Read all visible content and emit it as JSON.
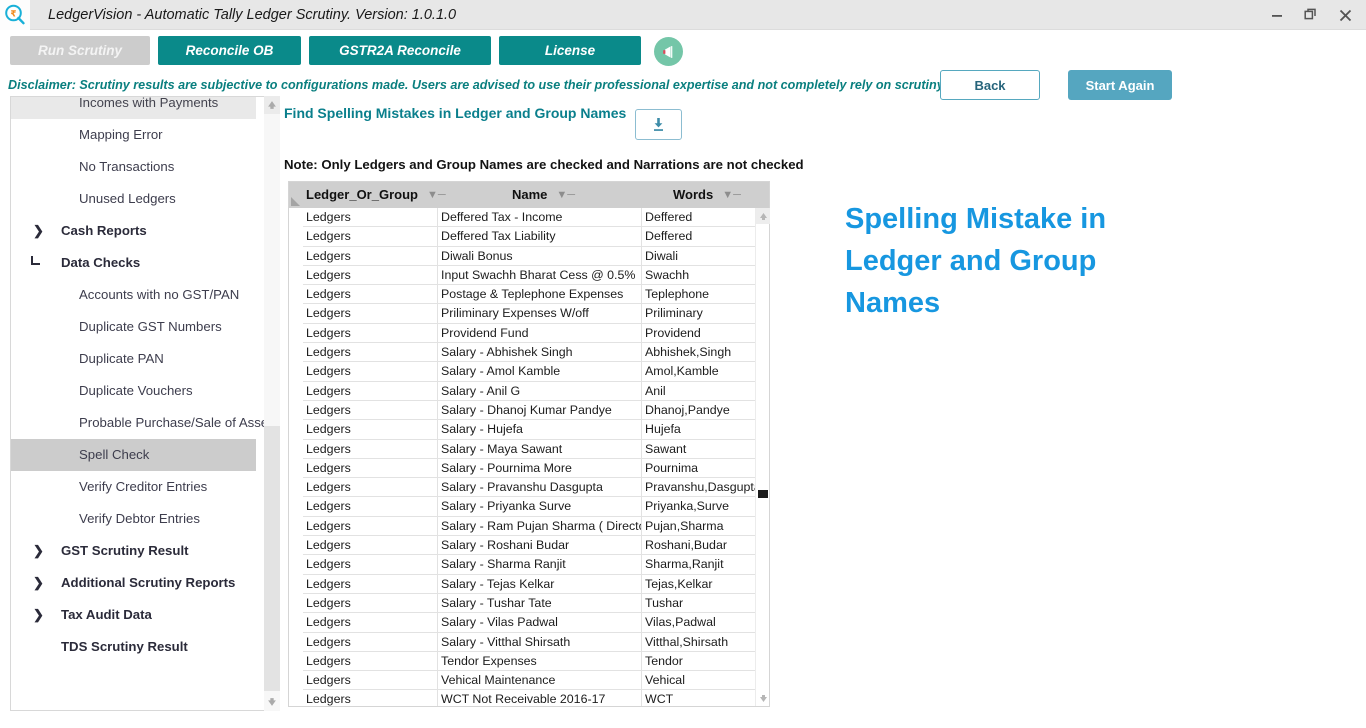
{
  "window": {
    "title": "LedgerVision - Automatic Tally Ledger Scrutiny.  Version: 1.0.1.0",
    "app_icon": "rupee-magnifier-icon",
    "minimize": "–",
    "maximize": "❐",
    "close": "✕"
  },
  "toolbar": {
    "run_scrutiny": "Run Scrutiny",
    "reconcile_ob": "Reconcile OB",
    "gstr2a_reconcile": "GSTR2A Reconcile",
    "license": "License",
    "announce_icon": "megaphone-icon",
    "colors": {
      "teal": "#0a8a8a",
      "disabled": "#cccccc",
      "accent_blue": "#55a6c0",
      "headline_blue": "#1797e0"
    }
  },
  "disclaimer": {
    "text": "Disclaimer: Scrutiny results are subjective to configurations made. Users are advised to use their professional expertise and not completely rely on scrutiny results.",
    "back": "Back",
    "start_again": "Start Again"
  },
  "sidebar": {
    "items": [
      {
        "label": "Incomes with Payments",
        "level": "child",
        "state": "partial"
      },
      {
        "label": "Mapping Error",
        "level": "child",
        "state": "normal"
      },
      {
        "label": "No Transactions",
        "level": "child",
        "state": "normal"
      },
      {
        "label": "Unused Ledgers",
        "level": "child",
        "state": "normal"
      },
      {
        "label": "Cash Reports",
        "level": "group",
        "state": "collapsed"
      },
      {
        "label": "Data Checks",
        "level": "group",
        "state": "expanded"
      },
      {
        "label": "Accounts with no GST/PAN",
        "level": "child",
        "state": "normal"
      },
      {
        "label": "Duplicate GST Numbers",
        "level": "child",
        "state": "normal"
      },
      {
        "label": "Duplicate PAN",
        "level": "child",
        "state": "normal"
      },
      {
        "label": "Duplicate Vouchers",
        "level": "child",
        "state": "normal"
      },
      {
        "label": "Probable Purchase/Sale of Assets",
        "level": "child",
        "state": "normal"
      },
      {
        "label": "Spell Check",
        "level": "child",
        "state": "selected"
      },
      {
        "label": "Verify Creditor Entries",
        "level": "child",
        "state": "normal"
      },
      {
        "label": "Verify Debtor Entries",
        "level": "child",
        "state": "normal"
      },
      {
        "label": "GST Scrutiny Result",
        "level": "group",
        "state": "collapsed"
      },
      {
        "label": "Additional Scrutiny Reports",
        "level": "group",
        "state": "collapsed"
      },
      {
        "label": "Tax Audit Data",
        "level": "group",
        "state": "collapsed"
      },
      {
        "label": "TDS Scrutiny Result",
        "level": "group",
        "state": "leaf"
      }
    ],
    "chevron_collapsed": "❯",
    "scroll_up_icon": "↑",
    "scroll_down_icon": "↓"
  },
  "content": {
    "title": "Find Spelling Mistakes in Ledger and Group Names",
    "download_icon": "download-icon",
    "note": "Note: Only Ledgers and Group Names are checked and Narrations are not checked",
    "right_headline": "Spelling Mistake in Ledger and Group Names"
  },
  "grid": {
    "columns": [
      "Ledger_Or_Group",
      "Name",
      "Words"
    ],
    "filter_icon": "᎒",
    "rows": [
      [
        "Ledgers",
        "Deffered Tax - Income",
        "Deffered"
      ],
      [
        "Ledgers",
        "Deffered Tax Liability",
        "Deffered"
      ],
      [
        "Ledgers",
        "Diwali Bonus",
        "Diwali"
      ],
      [
        "Ledgers",
        "Input Swachh Bharat Cess @ 0.5%",
        "Swachh"
      ],
      [
        "Ledgers",
        "Postage & Teplephone Expenses",
        "Teplephone"
      ],
      [
        "Ledgers",
        "Priliminary Expenses W/off",
        "Priliminary"
      ],
      [
        "Ledgers",
        "Providend Fund",
        "Providend"
      ],
      [
        "Ledgers",
        "Salary - Abhishek Singh",
        "Abhishek,Singh"
      ],
      [
        "Ledgers",
        "Salary - Amol Kamble",
        "Amol,Kamble"
      ],
      [
        "Ledgers",
        "Salary - Anil G",
        "Anil"
      ],
      [
        "Ledgers",
        "Salary - Dhanoj Kumar Pandye",
        "Dhanoj,Pandye"
      ],
      [
        "Ledgers",
        "Salary - Hujefa",
        "Hujefa"
      ],
      [
        "Ledgers",
        "Salary - Maya Sawant",
        "Sawant"
      ],
      [
        "Ledgers",
        "Salary - Pournima More",
        "Pournima"
      ],
      [
        "Ledgers",
        "Salary - Pravanshu Dasgupta",
        "Pravanshu,Dasgupta"
      ],
      [
        "Ledgers",
        "Salary - Priyanka Surve",
        "Priyanka,Surve"
      ],
      [
        "Ledgers",
        "Salary - Ram Pujan Sharma ( Director )",
        "Pujan,Sharma"
      ],
      [
        "Ledgers",
        "Salary - Roshani Budar",
        "Roshani,Budar"
      ],
      [
        "Ledgers",
        "Salary - Sharma Ranjit",
        "Sharma,Ranjit"
      ],
      [
        "Ledgers",
        "Salary - Tejas Kelkar",
        "Tejas,Kelkar"
      ],
      [
        "Ledgers",
        "Salary - Tushar Tate",
        "Tushar"
      ],
      [
        "Ledgers",
        "Salary - Vilas Padwal",
        "Vilas,Padwal"
      ],
      [
        "Ledgers",
        "Salary - Vitthal Shirsath",
        "Vitthal,Shirsath"
      ],
      [
        "Ledgers",
        "Tendor Expenses",
        "Tendor"
      ],
      [
        "Ledgers",
        "Vehical Maintenance",
        "Vehical"
      ],
      [
        "Ledgers",
        "WCT Not Receivable 2016-17",
        "WCT"
      ]
    ]
  }
}
